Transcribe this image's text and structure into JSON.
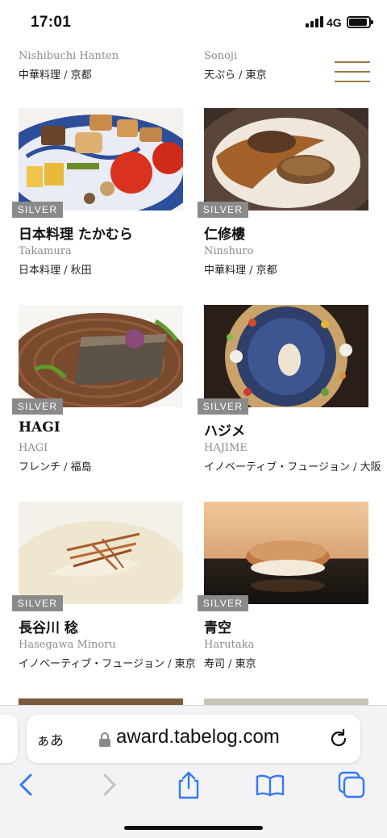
{
  "status_bar": {
    "time": "17:01",
    "network": "4G"
  },
  "top_row": [
    {
      "romaji": "Nishibuchi Hanten",
      "genre": "中華料理 / 京都"
    },
    {
      "romaji": "Sonoji",
      "genre": "天ぷら / 東京"
    }
  ],
  "restaurants": [
    {
      "badge": "SILVER",
      "name": "日本料理 たかむら",
      "romaji": "Takamura",
      "genre": "日本料理 / 秋田"
    },
    {
      "badge": "SILVER",
      "name": "仁修樓",
      "romaji": "Ninshuro",
      "genre": "中華料理 / 京都"
    },
    {
      "badge": "SILVER",
      "name": "HAGI",
      "romaji": "HAGI",
      "genre": "フレンチ / 福島"
    },
    {
      "badge": "SILVER",
      "name": "ハジメ",
      "romaji": "HAJIME",
      "genre": "イノベーティブ・フュージョン / 大阪"
    },
    {
      "badge": "SILVER",
      "name": "長谷川 稔",
      "romaji": "Hasegawa Minoru",
      "genre": "イノベーティブ・フュージョン / 東京"
    },
    {
      "badge": "SILVER",
      "name": "青空",
      "romaji": "Harutaka",
      "genre": "寿司 / 東京"
    }
  ],
  "browser": {
    "aa_label": "ぁあ",
    "url": "award.tabelog.com"
  },
  "icons": {
    "menu": "hamburger-menu-icon",
    "lock": "lock-icon",
    "reload": "reload-icon",
    "back": "back-chevron-icon",
    "forward": "forward-chevron-icon",
    "share": "share-icon",
    "bookmarks": "bookmarks-icon",
    "tabs": "tabs-icon"
  },
  "colors": {
    "accent_gold": "#9a7d44",
    "badge_gray": "#8a8a8a",
    "ios_blue": "#3478f6"
  }
}
